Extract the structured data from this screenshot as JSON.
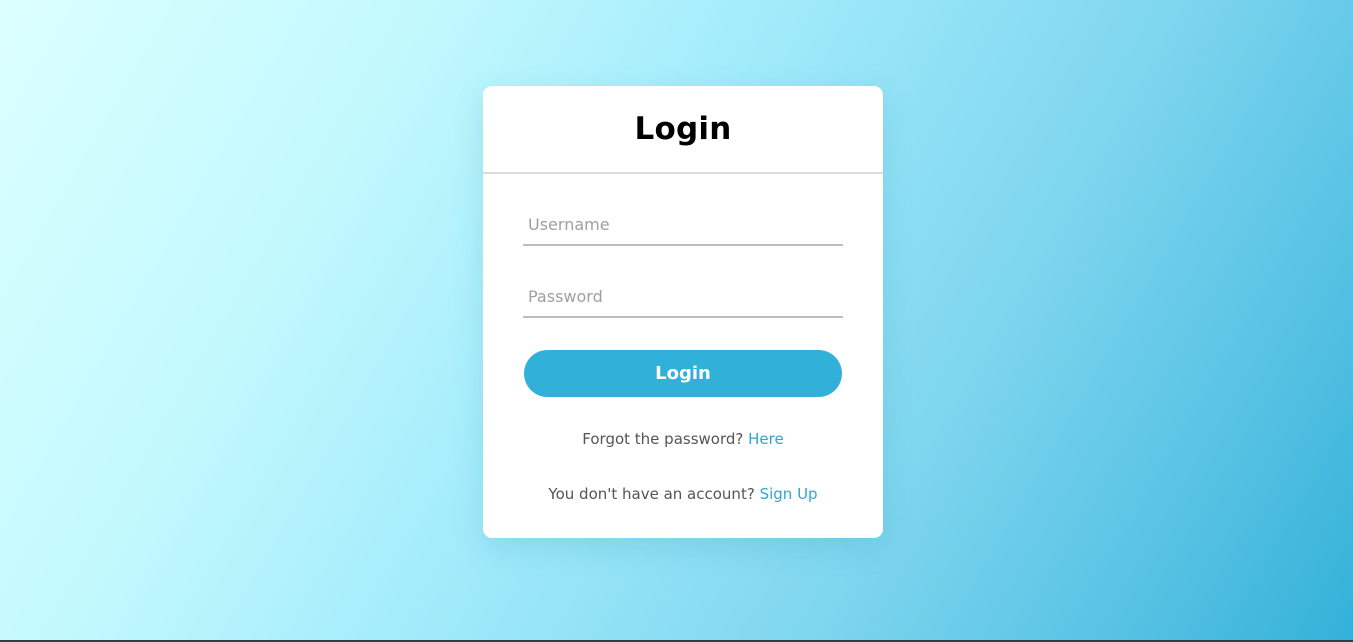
{
  "login_card": {
    "title": "Login",
    "username_placeholder": "Username",
    "password_placeholder": "Password",
    "login_button_label": "Login",
    "forgot_text": "Forgot the password?",
    "forgot_link": "Here",
    "signup_text": "You don't have an account?",
    "signup_link": "Sign Up"
  },
  "colors": {
    "accent": "#31b0d9",
    "link": "#31a6cf",
    "background_start": "#dcffff",
    "background_end": "#33b1d8"
  }
}
